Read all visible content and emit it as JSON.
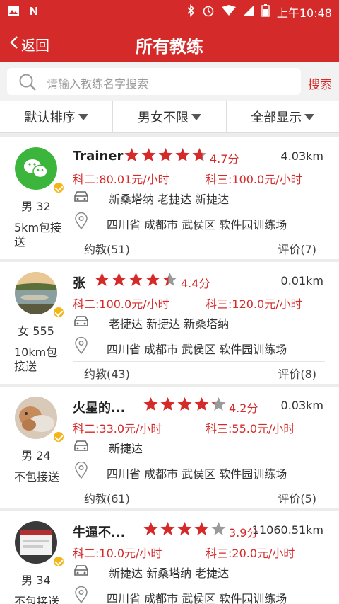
{
  "statusbar": {
    "time": "上午10:48"
  },
  "header": {
    "back_label": "返回",
    "title": "所有教练"
  },
  "search": {
    "placeholder": "请输入教练名字搜索",
    "button_label": "搜索"
  },
  "filters": [
    {
      "label": "默认排序"
    },
    {
      "label": "男女不限"
    },
    {
      "label": "全部显示"
    }
  ],
  "colors": {
    "brand": "#d42a2a",
    "star": "#d42a2a",
    "star_empty": "#9a9a9a",
    "badge": "#f3b51a"
  },
  "labels": {
    "subject2_prefix": "科二:",
    "subject3_prefix": "科三:",
    "bookings_prefix": "约教",
    "reviews_prefix": "评价"
  },
  "coaches": [
    {
      "name": "Trainer",
      "avatar_icon": "wechat-icon",
      "rating": 4.7,
      "rating_text": "4.7分",
      "distance": "4.03km",
      "subject2": "科二:80.01元/小时",
      "subject3": "科三:100.0元/小时",
      "schools": "新桑塔纳 老捷达 新捷达",
      "address": "四川省 成都市 武侯区 软件园训练场",
      "gender_age": "男  32",
      "pickup": "5km包接送",
      "bookings": "约教(51)",
      "reviews": "评价(7)"
    },
    {
      "name": "张",
      "avatar_icon": "landscape-photo",
      "rating": 4.4,
      "rating_text": "4.4分",
      "distance": "0.01km",
      "subject2": "科二:100.0元/小时",
      "subject3": "科三:120.0元/小时",
      "schools": "老捷达 新捷达 新桑塔纳",
      "address": "四川省 成都市 武侯区 软件园训练场",
      "gender_age": "女  555",
      "pickup": "10km包接送",
      "bookings": "约教(43)",
      "reviews": "评价(8)"
    },
    {
      "name": "火星的...",
      "avatar_icon": "cat-photo",
      "rating": 4.2,
      "rating_text": "4.2分",
      "distance": "0.03km",
      "subject2": "科二:33.0元/小时",
      "subject3": "科三:55.0元/小时",
      "schools": "新捷达",
      "address": "四川省 成都市 武侯区 软件园训练场",
      "gender_age": "男  24",
      "pickup": "不包接送",
      "bookings": "约教(61)",
      "reviews": "评价(5)"
    },
    {
      "name": "牛逼不...",
      "avatar_icon": "screenshot-photo",
      "rating": 3.9,
      "rating_text": "3.9分",
      "distance": "11060.51km",
      "subject2": "科二:10.0元/小时",
      "subject3": "科三:20.0元/小时",
      "schools": "新捷达 新桑塔纳 老捷达",
      "address": "四川省 成都市 武侯区 软件园训练场",
      "gender_age": "男  34",
      "pickup": "不包接送",
      "bookings": "",
      "reviews": ""
    }
  ]
}
